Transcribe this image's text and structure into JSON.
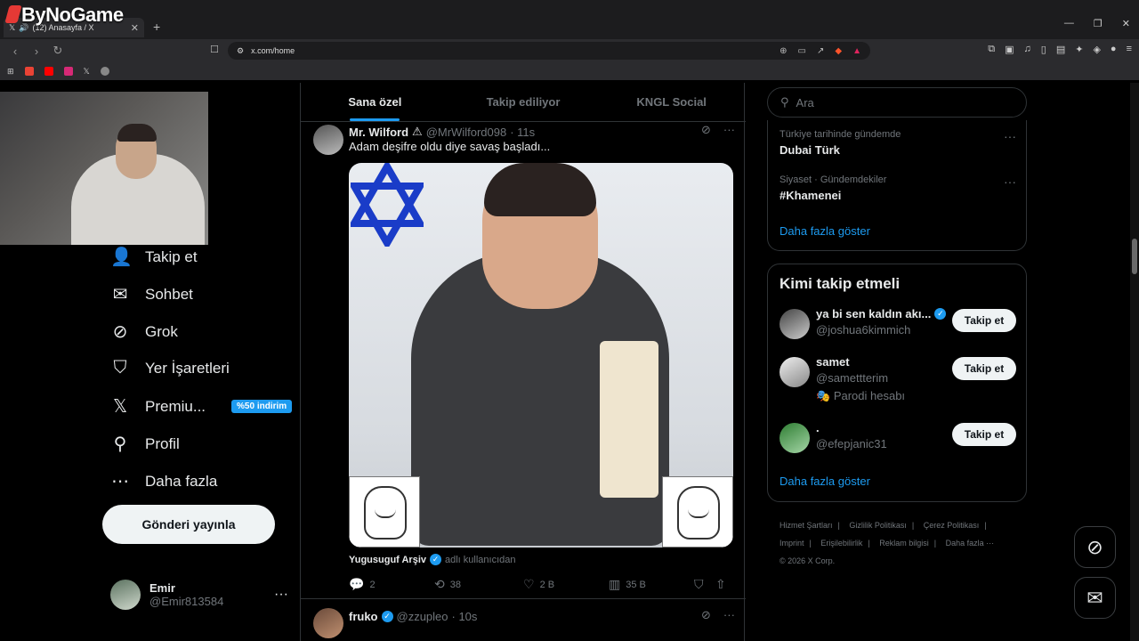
{
  "watermark": "ByNoGame",
  "browser": {
    "tab_title": "(12) Anasayfa / X",
    "url": "x.com/home"
  },
  "nav": {
    "items": [
      {
        "label": "Takip et",
        "icon": "add-person-icon"
      },
      {
        "label": "Sohbet",
        "icon": "mail-icon"
      },
      {
        "label": "Grok",
        "icon": "grok-icon"
      },
      {
        "label": "Yer İşaretleri",
        "icon": "bookmark-icon"
      },
      {
        "label": "Premiu...",
        "icon": "x-logo-icon",
        "badge": "%50 indirim"
      },
      {
        "label": "Profil",
        "icon": "person-icon"
      },
      {
        "label": "Daha fazla",
        "icon": "more-circle-icon"
      }
    ],
    "post_button": "Gönderi yayınla",
    "account": {
      "name": "Emir",
      "handle": "@Emir813584"
    }
  },
  "feed": {
    "tabs": [
      "Sana özel",
      "Takip ediliyor",
      "KNGL Social"
    ],
    "active_tab": 0,
    "tweet1": {
      "name": "Mr. Wilford",
      "handle": "@MrWilford098",
      "time": "· 11s",
      "text": "Adam deşifre oldu diye savaş başladı...",
      "social_user": "Yugusuguf Arşiv",
      "social_suffix": "adlı kullanıcıdan",
      "replies": "2",
      "reposts": "38",
      "likes": "2 B",
      "views": "35 B"
    },
    "tweet2": {
      "name": "fruko",
      "handle": "@zzupleo",
      "time": "· 10s"
    }
  },
  "right": {
    "search_placeholder": "Ara",
    "trends": [
      {
        "meta": "Türkiye tarihinde gündemde",
        "name": "Dubai Türk"
      },
      {
        "meta": "Siyaset · Gündemdekiler",
        "name": "#Khamenei"
      }
    ],
    "trends_show_more": "Daha fazla göster",
    "follow_title": "Kimi takip etmeli",
    "suggestions": [
      {
        "name": "ya bi sen kaldın akı...",
        "handle": "@joshua6kimmich",
        "verified": true,
        "button": "Takip et"
      },
      {
        "name": "samet",
        "handle": "@samettterim",
        "extra": "Parodi hesabı",
        "button": "Takip et"
      },
      {
        "name": ".",
        "handle": "@efepjanic31",
        "button": "Takip et"
      }
    ],
    "follow_show_more": "Daha fazla göster",
    "footer": [
      "Hizmet Şartları",
      "Gizlilik Politikası",
      "Çerez Politikası",
      "Imprint",
      "Erişilebilirlik",
      "Reklam bilgisi",
      "Daha fazla ···",
      "© 2026 X Corp."
    ]
  },
  "colors": {
    "accent": "#1d9bf0",
    "bg": "#000000",
    "border": "#2f3336"
  }
}
